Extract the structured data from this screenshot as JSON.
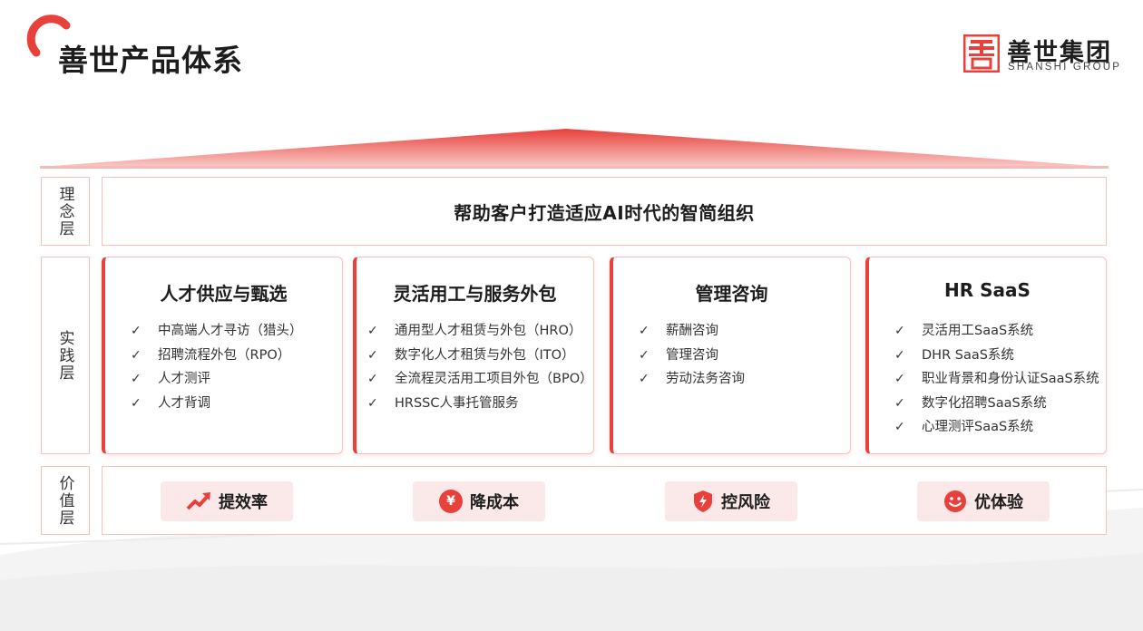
{
  "header": {
    "title": "善世产品体系",
    "brand_name": "善世集团",
    "brand_sub": "SHANSHI GROUP"
  },
  "colors": {
    "accent": "#e8403a",
    "border": "#f3c3c3",
    "pill_bg": "#fbe9e9"
  },
  "layers": {
    "concept_label": "理念层",
    "practice_label": "实践层",
    "value_label": "价值层"
  },
  "concept": {
    "text": "帮助客户打造适应AI时代的智简组织"
  },
  "cards": [
    {
      "title": "人才供应与甄选",
      "items": [
        "中高端人才寻访（猎头）",
        "招聘流程外包（RPO）",
        "人才测评",
        "人才背调"
      ]
    },
    {
      "title": "灵活用工与服务外包",
      "items": [
        "通用型人才租赁与外包（HRO）",
        "数字化人才租赁与外包（ITO）",
        "全流程灵活用工项目外包（BPO）",
        "HRSSC人事托管服务"
      ]
    },
    {
      "title": "管理咨询",
      "items": [
        "薪酬咨询",
        "管理咨询",
        "劳动法务咨询"
      ]
    },
    {
      "title": "HR SaaS",
      "items": [
        "灵活用工SaaS系统",
        "DHR SaaS系统",
        "职业背景和身份认证SaaS系统",
        "数字化招聘SaaS系统",
        "心理测评SaaS系统"
      ]
    }
  ],
  "values": [
    {
      "label": "提效率",
      "icon": "trend-up-icon"
    },
    {
      "label": "降成本",
      "icon": "yen-icon"
    },
    {
      "label": "控风险",
      "icon": "shield-bolt-icon"
    },
    {
      "label": "优体验",
      "icon": "smile-icon"
    }
  ],
  "check_glyph": "✓"
}
